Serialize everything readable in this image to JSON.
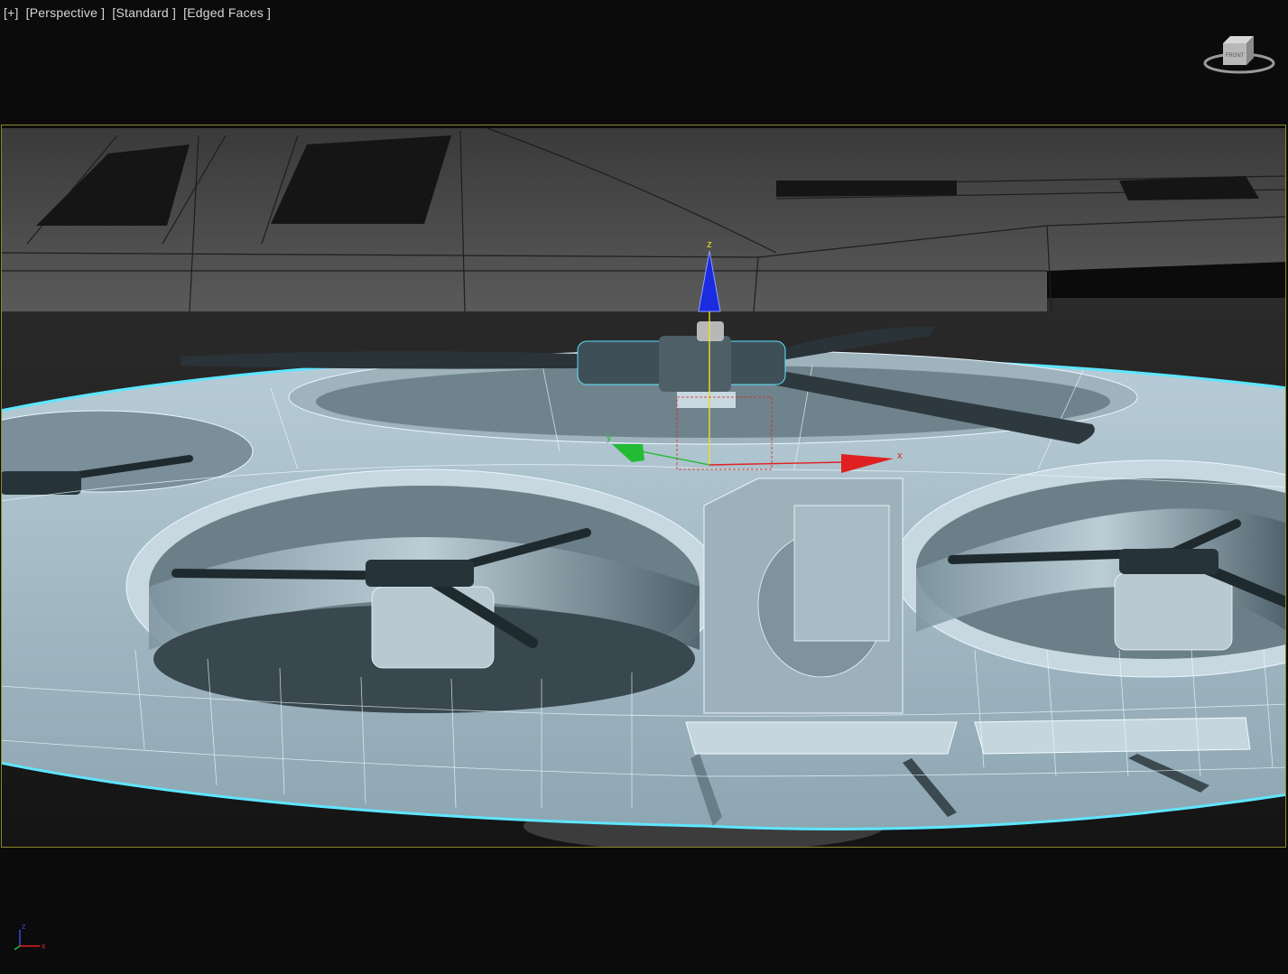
{
  "viewport": {
    "menu_plus": "[+]",
    "view_label": "[Perspective ]",
    "shading_label": "[Standard ]",
    "display_label": "[Edged Faces ]"
  },
  "viewcube": {
    "face_label": "FRONT",
    "icon": "viewcube-icon"
  },
  "gizmo": {
    "z_label": "z",
    "x_label": "x",
    "y_label": "y"
  },
  "tripod": {
    "z_label": "z",
    "x_label": "x"
  },
  "colors": {
    "background": "#0b0b0b",
    "safe_frame": "#8a8a2a",
    "selection_wire": "#5ee6ff",
    "model_fill": "#a9c0cb",
    "axis_x": "#e02020",
    "axis_y": "#22bb33",
    "axis_z": "#1a2be0"
  }
}
